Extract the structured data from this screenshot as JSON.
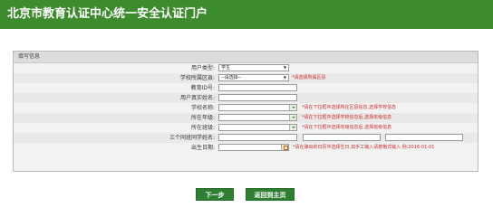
{
  "header": {
    "title": "北京市教育认证中心统一安全认证门户"
  },
  "form": {
    "section_title": "填写信息",
    "fields": {
      "user_type": {
        "label": "用户类型:",
        "value": "学生"
      },
      "district": {
        "label": "学校所属区县:",
        "value": "--请选择--",
        "hint": "*请选择所属区县"
      },
      "edu_id": {
        "label": "教育ID号:",
        "value": ""
      },
      "real_name": {
        "label": "用户真实姓名:",
        "value": ""
      },
      "school": {
        "label": "学校名称:",
        "value": "",
        "hint": "*请在下拉框中选择所在区县信息,选择学校信息"
      },
      "grade": {
        "label": "所在年级:",
        "value": "",
        "hint": "*请在下拉框中选择学校信息后,选择年级信息"
      },
      "class": {
        "label": "所在班级:",
        "value": "",
        "hint": "*请在下拉框中选择年级信息后,选择班级信息"
      },
      "classmates": {
        "label": "三个同班同学姓名:",
        "values": [
          "",
          "",
          ""
        ]
      },
      "birthday": {
        "label": "出生日期:",
        "value": "",
        "hint": "*请在弹出的日历中选择生日,如手工输入请按格式输入 例:2016-01-01"
      }
    }
  },
  "buttons": {
    "next": "下一步",
    "home": "返回到主页"
  },
  "colors": {
    "banner": "#3c8b2c",
    "button": "#2f7f33",
    "hint": "#cc2a2a"
  }
}
